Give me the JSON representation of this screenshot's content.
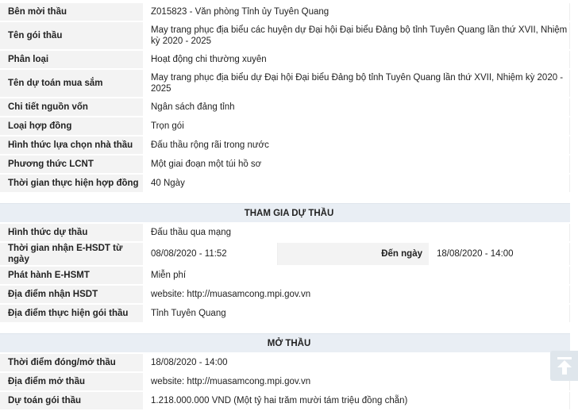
{
  "info": [
    {
      "label": "Bên mời thầu",
      "value": "Z015823 - Văn phòng Tỉnh ủy Tuyên Quang"
    },
    {
      "label": "Tên gói thầu",
      "value": "May trang phục địa biểu các huyện dự Đại hội Đại biểu Đảng bộ tỉnh Tuyên Quang lần thứ XVII, Nhiệm kỳ 2020 - 2025"
    },
    {
      "label": "Phân loại",
      "value": "Hoạt động chi thường xuyên"
    },
    {
      "label": "Tên dự toán mua sắm",
      "value": "May trang phục địa biểu dự Đại hội Đại biểu Đảng bộ tỉnh Tuyên Quang lần thứ XVII, Nhiệm kỳ 2020 - 2025"
    },
    {
      "label": "Chi tiết nguồn vốn",
      "value": "Ngân sách đảng tỉnh"
    },
    {
      "label": "Loại hợp đồng",
      "value": "Trọn gói"
    },
    {
      "label": "Hình thức lựa chọn nhà thầu",
      "value": "Đấu thầu rộng rãi trong nước"
    },
    {
      "label": "Phương thức LCNT",
      "value": "Một giai đoạn một túi hồ sơ"
    },
    {
      "label": "Thời gian thực hiện hợp đồng",
      "value": "40 Ngày"
    }
  ],
  "participation": {
    "title": "THAM GIA DỰ THẦU",
    "form_label": "Hình thức dự thầu",
    "form_value": "Đấu thầu qua mạng",
    "time_label": "Thời gian nhận E-HSDT từ ngày",
    "time_from": "08/08/2020 - 11:52",
    "to_label": "Đến ngày",
    "time_to": "18/08/2020 - 14:00",
    "issue_label": "Phát hành E-HSMT",
    "issue_value": "Miễn phí",
    "receive_label": "Địa điểm nhận HSDT",
    "receive_value": "website: http://muasamcong.mpi.gov.vn",
    "place_label": "Địa điểm thực hiện gói thầu",
    "place_value": "Tỉnh Tuyên Quang"
  },
  "opening": {
    "title": "MỞ THẦU",
    "time_label": "Thời điểm đóng/mở thầu",
    "time_value": "18/08/2020 - 14:00",
    "place_label": "Địa điểm mở thầu",
    "place_value": "website: http://muasamcong.mpi.gov.vn",
    "budget_label": "Dự toán gói thầu",
    "budget_value": "1.218.000.000 VND (Một tỷ hai trăm mười tám triệu đồng chẵn)"
  },
  "icons": {
    "scroll_top": "arrow-up-to-top-icon"
  }
}
